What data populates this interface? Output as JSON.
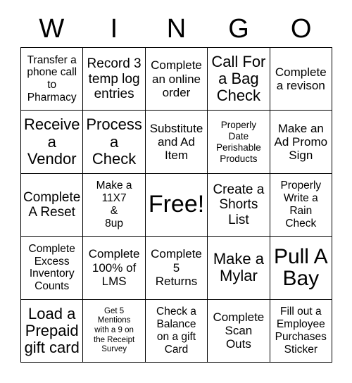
{
  "card": {
    "title_letters": [
      "W",
      "I",
      "N",
      "G",
      "O"
    ],
    "columns": 5,
    "rows": 5,
    "free_space_label": "Free!",
    "free_space_position": "row3-col3",
    "background_color": "#ffffff",
    "border_color": "#000000",
    "text_color": "#000000",
    "cells": [
      [
        "Transfer a\nphone call\nto\nPharmacy",
        "Record 3\ntemp log\nentries",
        "Complete\nan online\norder",
        "Call For\na Bag\nCheck",
        "Complete\na revison"
      ],
      [
        "Receive\na\nVendor",
        "Process\na\nCheck",
        "Substitute\nand Ad\nItem",
        "Properly\nDate\nPerishable\nProducts",
        "Make an\nAd Promo\nSign"
      ],
      [
        "Complete\nA Reset",
        "Make a\n11X7\n&\n8up",
        "Free!",
        "Create a\nShorts\nList",
        "Properly\nWrite a\nRain\nCheck"
      ],
      [
        "Complete\nExcess\nInventory\nCounts",
        "Complete\n100% of\nLMS",
        "Complete\n5\nReturns",
        "Make a\nMylar",
        "Pull A\nBay"
      ],
      [
        "Load a\nPrepaid\ngift card",
        "Get 5\nMentions\nwith a 9 on\nthe Receipt\nSurvey",
        "Check a\nBalance\non a gift\nCard",
        "Complete\nScan\nOuts",
        "Fill out a\nEmployee\nPurchases\nSticker"
      ]
    ]
  }
}
